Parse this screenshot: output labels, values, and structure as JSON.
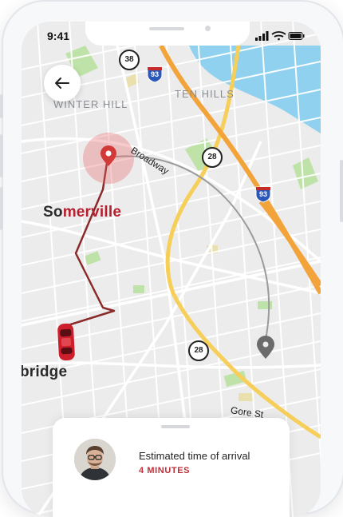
{
  "status_bar": {
    "time": "9:41"
  },
  "map": {
    "neighborhoods": [
      "WINTER HILL",
      "TEN HILLS"
    ],
    "city": {
      "prefix": "So",
      "highlight": "merville"
    },
    "city_partial": "bridge",
    "roads": {
      "broadway": "Broadway",
      "gore_st": "Gore St"
    },
    "shields": {
      "route_38": "38",
      "route_28_a": "28",
      "route_28_b": "28"
    },
    "interstates": {
      "i93_a": "93",
      "i93_b": "93"
    }
  },
  "trip": {
    "eta_label": "Estimated time of arrival",
    "eta_value": "4 MINUTES"
  },
  "colors": {
    "route": "#8b2a2a",
    "pickup": "#d23a3a",
    "highway": "#f2a33a",
    "major_road": "#f6cf5a",
    "water": "#8fd1ee",
    "park": "#bfe2a8"
  },
  "icons": [
    "back-arrow-icon",
    "pickup-pin-icon",
    "destination-pin-icon",
    "car-icon",
    "signal-icon",
    "wifi-icon",
    "battery-icon"
  ]
}
